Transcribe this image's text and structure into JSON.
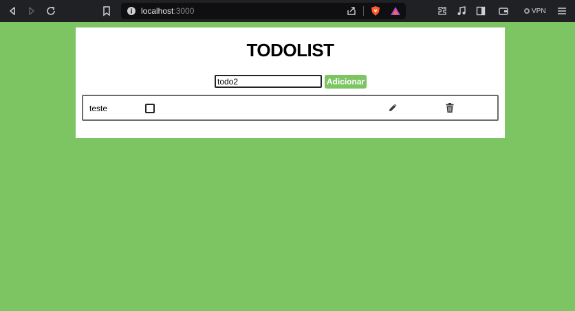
{
  "browser": {
    "url_host": "localhost",
    "url_port": ":3000",
    "vpn_label": "VPN"
  },
  "app": {
    "title": "TODOLIST",
    "input": {
      "value": "todo2"
    },
    "add_button_label": "Adicionar",
    "todos": [
      {
        "text": "teste",
        "completed": false
      }
    ]
  },
  "icons": {
    "edit": "pencil-icon",
    "delete": "trash-icon"
  },
  "colors": {
    "background": "#7dc462",
    "accent": "#7dc462",
    "card": "#ffffff"
  }
}
